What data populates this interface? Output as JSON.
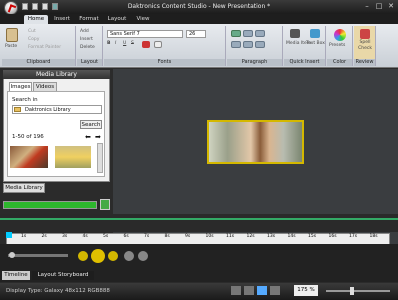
{
  "window": {
    "title": "Daktronics Content Studio - New Presentation *",
    "min": "–",
    "max": "□",
    "close": "✕"
  },
  "tabs": [
    "Home",
    "Insert",
    "Format",
    "Layout",
    "View"
  ],
  "ribbon": {
    "clipboard": {
      "label": "Clipboard",
      "paste": "Paste",
      "cut": "Cut",
      "copy": "Copy",
      "format": "Format Painter"
    },
    "layout": {
      "label": "Layout",
      "add": "Add",
      "insert": "Insert",
      "delete": "Delete"
    },
    "fonts": {
      "label": "Fonts",
      "font": "Sans Serif 7",
      "size": "26",
      "bold": "B",
      "italic": "I",
      "underline": "U",
      "strike": "S"
    },
    "paragraph": {
      "label": "Paragraph"
    },
    "quick_insert": {
      "label": "Quick Insert",
      "media": "Media Item",
      "text": "Text Box"
    },
    "color": {
      "label": "Color",
      "presets": "Presets"
    },
    "review": {
      "label": "Review",
      "spell": "Spell Check"
    }
  },
  "media_library": {
    "title": "Media Library",
    "tabs": [
      "Images",
      "Videos"
    ],
    "search_in_label": "Search in",
    "library": "Daktronics Library",
    "search": "Search",
    "count": "1-50 of 196",
    "button": "Media Library"
  },
  "timeline": {
    "ticks": [
      "1s",
      "2s",
      "3s",
      "4s",
      "5s",
      "6s",
      "7s",
      "8s",
      "9s",
      "10s",
      "11s",
      "12s",
      "13s",
      "14s",
      "15s",
      "16s",
      "17s",
      "18s"
    ],
    "tabs": [
      "Timeline",
      "Layout Storyboard"
    ]
  },
  "status": {
    "display": "Display Type: Galaxy 48x112 RGB888",
    "zoom": "175 %"
  }
}
